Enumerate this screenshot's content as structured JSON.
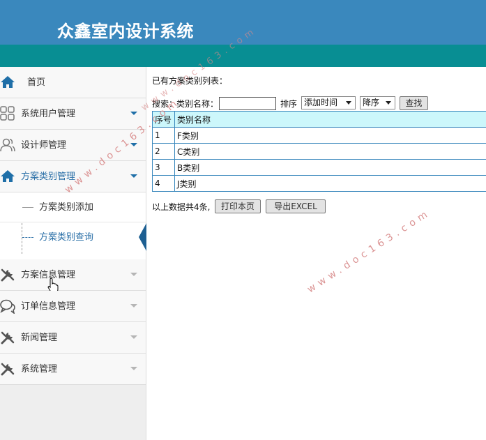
{
  "app": {
    "title": "众鑫室内设计系统"
  },
  "colors": {
    "header": "#3a88bd",
    "teal_bar": "#088e93",
    "table_border": "#3a88bd",
    "table_header_bg": "#ccf7fb",
    "active_text": "#2a6fa7"
  },
  "sidebar": {
    "home": {
      "label": "首页",
      "icon": "home-icon"
    },
    "items": [
      {
        "label": "系统用户管理",
        "icon": "grid-icon"
      },
      {
        "label": "设计师管理",
        "icon": "users-icon"
      },
      {
        "label": "方案类别管理",
        "icon": "home-icon"
      },
      {
        "label": "方案信息管理",
        "icon": "wrench-icon"
      },
      {
        "label": "订单信息管理",
        "icon": "chat-icon"
      },
      {
        "label": "新闻管理",
        "icon": "wrench-icon"
      },
      {
        "label": "系统管理",
        "icon": "wrench-icon"
      }
    ],
    "subitems": [
      {
        "label": "方案类别添加"
      },
      {
        "label": "方案类别查询"
      }
    ]
  },
  "main": {
    "list_title": "已有方案类别列表：",
    "search": {
      "prefix": "搜索：",
      "field_label": "类别名称：",
      "value": "",
      "sort_label": "排序",
      "sort_field": "添加时间",
      "sort_order": "降序",
      "button": "查找"
    },
    "table": {
      "columns": [
        "序号",
        "类别名称"
      ],
      "rows": [
        [
          "1",
          "F类别"
        ],
        [
          "2",
          "C类别"
        ],
        [
          "3",
          "B类别"
        ],
        [
          "4",
          "J类别"
        ]
      ]
    },
    "summary": {
      "text": "以上数据共4条,",
      "print_button": "打印本页",
      "export_button": "导出EXCEL"
    }
  },
  "watermarks": [
    "www.doc163.com",
    "www.doc163.com",
    "www.doc163.com"
  ]
}
